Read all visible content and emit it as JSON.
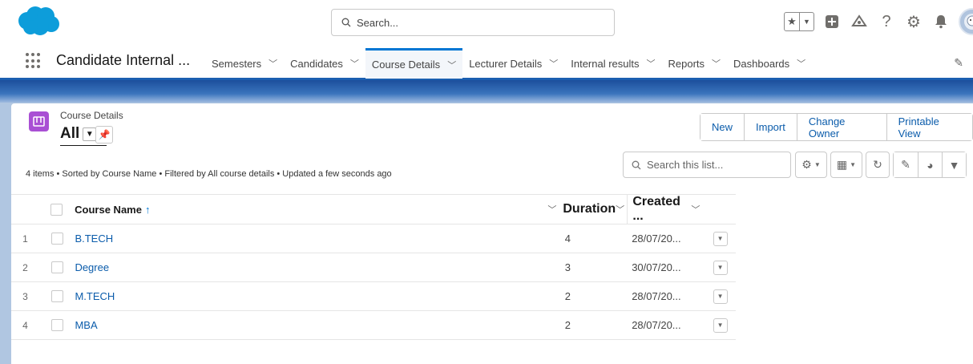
{
  "header": {
    "search_placeholder": "Search...",
    "icons": [
      "favorites-star-icon",
      "favorites-dropdown-icon",
      "add-icon",
      "trailhead-icon",
      "help-icon",
      "setup-gear-icon",
      "notifications-bell-icon",
      "avatar"
    ],
    "brand_color": "#0d9dda"
  },
  "nav": {
    "app_name": "Candidate Internal ...",
    "tabs": [
      {
        "label": "Semesters",
        "active": false
      },
      {
        "label": "Candidates",
        "active": false
      },
      {
        "label": "Course Details",
        "active": true
      },
      {
        "label": "Lecturer Details",
        "active": false
      },
      {
        "label": "Internal results",
        "active": false
      },
      {
        "label": "Reports",
        "active": false
      },
      {
        "label": "Dashboards",
        "active": false
      }
    ]
  },
  "list_view": {
    "object_label": "Course Details",
    "view_name": "All",
    "buttons": [
      "New",
      "Import",
      "Change Owner",
      "Printable View"
    ],
    "search_placeholder": "Search this list...",
    "summary": "4 items • Sorted by Course Name • Filtered by All course details • Updated a few seconds ago",
    "columns": {
      "name": "Course Name",
      "duration": "Duration",
      "created": "Created ..."
    },
    "rows": [
      {
        "num": "1",
        "name": "B.TECH",
        "duration": "4",
        "created": "28/07/20..."
      },
      {
        "num": "2",
        "name": "Degree",
        "duration": "3",
        "created": "30/07/20..."
      },
      {
        "num": "3",
        "name": "M.TECH",
        "duration": "2",
        "created": "28/07/20..."
      },
      {
        "num": "4",
        "name": "MBA",
        "duration": "2",
        "created": "28/07/20..."
      }
    ]
  },
  "colors": {
    "accent": "#0176d3",
    "link": "#0b5cab",
    "object_icon": "#a94fd4",
    "nav_border": "#1b5fb0"
  }
}
